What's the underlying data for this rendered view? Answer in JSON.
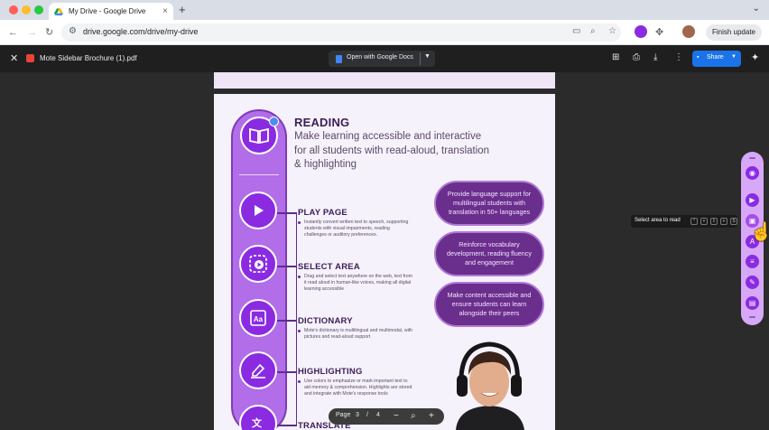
{
  "browser": {
    "tab_title": "My Drive - Google Drive",
    "new_tab": "+",
    "tab_close": "×",
    "address": "drive.google.com/drive/my-drive",
    "finish_update": "Finish update"
  },
  "viewer": {
    "close": "✕",
    "file_name": "Mote Sidebar Brochure (1).pdf",
    "open_with": "Open with Google Docs",
    "share": "Share"
  },
  "brochure": {
    "heading": "READING",
    "description": "Make learning accessible and interactive for all students with read-aloud, translation & highlighting",
    "sections": [
      {
        "title": "PLAY PAGE",
        "body": "Instantly convert written text to speech, supporting students with visual impairments, reading challenges or auditory preferences."
      },
      {
        "title": "SELECT AREA",
        "body": "Drag and select text anywhere on the web, text from it read aloud in human-like voices, making all digital learning accessible"
      },
      {
        "title": "DICTIONARY",
        "body": "Mote's dictionary is multilingual and multimodal, with pictures and read-aloud support"
      },
      {
        "title": "HIGHLIGHTING",
        "body": "Use colors to emphasize or mark important text to aid memory & comprehension. Highlights are stored and integrate with Mote's response tools"
      },
      {
        "title": "TRANSLATE",
        "body": ""
      }
    ],
    "pills": [
      "Provide language support for multilingual students with translation in 50+ languages",
      "Reinforce vocabulary development, reading fluency and engagement",
      "Make content accessible and ensure students can learn alongside their peers"
    ]
  },
  "pager": {
    "label": "Page",
    "current": "3",
    "separator": "/",
    "total": "4"
  },
  "mote_tooltip": {
    "text": "Select area to read"
  },
  "colors": {
    "brand_purple": "#8a2be2",
    "spine": "#b26de8",
    "pill": "#6a2e8c",
    "share_blue": "#1a73e8"
  }
}
